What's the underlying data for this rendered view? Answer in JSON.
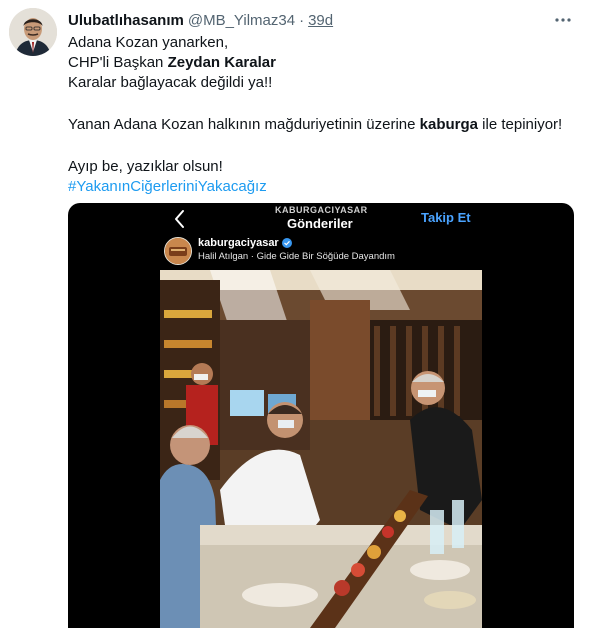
{
  "tweet": {
    "display_name": "Ulubatlıhasanım",
    "handle": "@MB_Yilmaz34",
    "separator": "·",
    "time": "39d",
    "lines": {
      "l1": "Adana Kozan yanarken,",
      "l2_prefix": "CHP'li Başkan ",
      "l2_bold": "Zeydan Karalar",
      "l3": "Karalar bağlayacak değildi ya!!",
      "l4_prefix": "Yanan Adana Kozan halkının mağduriyetinin üzerine ",
      "l4_bold": "kaburga",
      "l4_suffix": " ile tepiniyor!",
      "l5": "Ayıp be, yazıklar olsun!",
      "hashtag": "#YakanınCiğerleriniYakacağız"
    }
  },
  "instagram": {
    "top_username": "KABURGACIYASAR",
    "title": "Gönderiler",
    "follow": "Takip Et",
    "username": "kaburgaciyasar",
    "song": "Halil Atılgan · Gide Gide Bir Söğüde Dayandım"
  },
  "icons": {
    "more": "more-horizontal-icon",
    "back": "chevron-left-icon",
    "verified": "verified-badge-icon"
  },
  "colors": {
    "link": "#1d9bf0",
    "secondary_text": "#536471",
    "ig_follow": "#4aa3ff"
  }
}
